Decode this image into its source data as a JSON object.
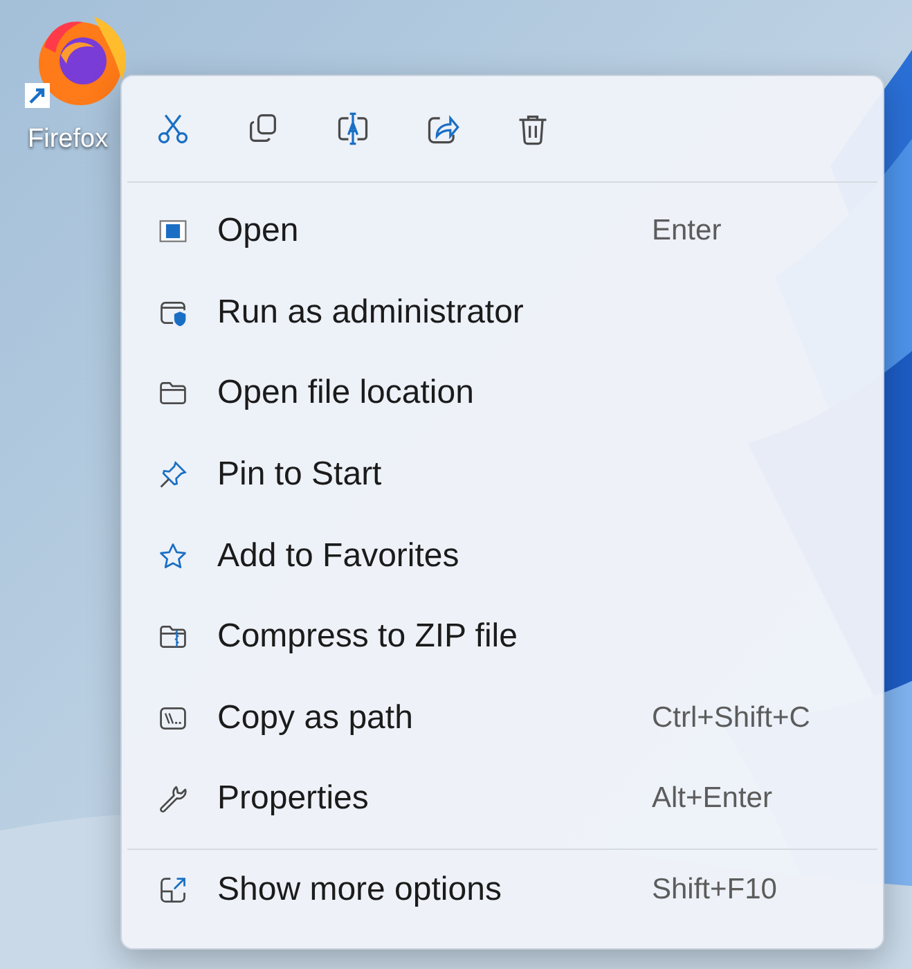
{
  "desktop": {
    "shortcut": {
      "label": "Firefox"
    }
  },
  "menu": {
    "toolbar": [
      {
        "kind": "cut"
      },
      {
        "kind": "copy"
      },
      {
        "kind": "rename"
      },
      {
        "kind": "share"
      },
      {
        "kind": "delete"
      }
    ],
    "items": [
      {
        "kind": "open",
        "label": "Open",
        "shortcut": "Enter"
      },
      {
        "kind": "admin",
        "label": "Run as administrator"
      },
      {
        "kind": "folder",
        "label": "Open file location"
      },
      {
        "kind": "pin",
        "label": "Pin to Start"
      },
      {
        "kind": "star",
        "label": "Add to Favorites"
      },
      {
        "kind": "zip",
        "label": "Compress to ZIP file"
      },
      {
        "kind": "path",
        "label": "Copy as path",
        "shortcut": "Ctrl+Shift+C"
      },
      {
        "kind": "wrench",
        "label": "Properties",
        "shortcut": "Alt+Enter"
      }
    ],
    "more": {
      "kind": "more",
      "label": "Show more options",
      "shortcut": "Shift+F10"
    }
  }
}
